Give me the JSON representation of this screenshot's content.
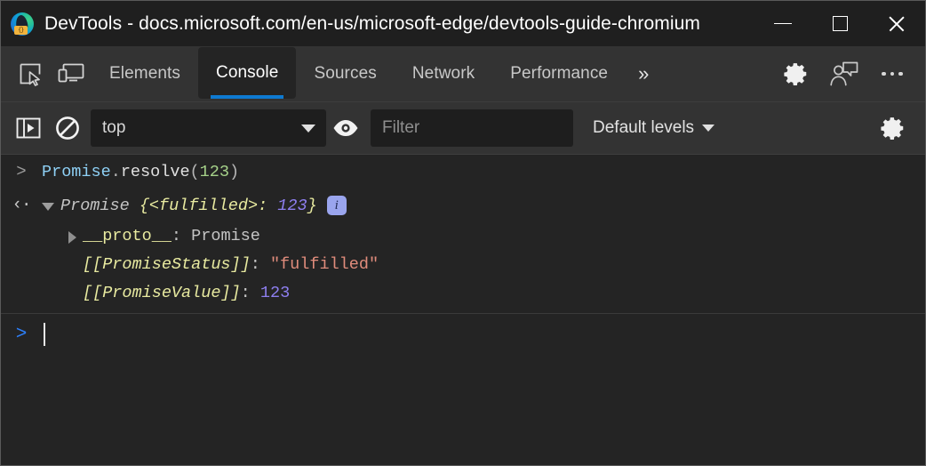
{
  "window": {
    "title": "DevTools - docs.microsoft.com/en-us/microsoft-edge/devtools-guide-chromium",
    "app_icon": "edge-devtools-icon",
    "badge_text": "{}",
    "controls": {
      "minimize": "minimize-icon",
      "maximize": "maximize-icon",
      "close": "close-icon"
    }
  },
  "tabbar": {
    "inspect_icon": "inspect-element-icon",
    "device_icon": "device-emulation-icon",
    "tabs": [
      {
        "label": "Elements",
        "active": false
      },
      {
        "label": "Console",
        "active": true
      },
      {
        "label": "Sources",
        "active": false
      },
      {
        "label": "Network",
        "active": false
      },
      {
        "label": "Performance",
        "active": false
      }
    ],
    "more_tabs": "»",
    "settings_icon": "gear-icon",
    "feedback_icon": "feedback-person-icon",
    "more_icon": "more-options-icon",
    "active_underline_color": "#0e7ad1"
  },
  "console_toolbar": {
    "sidebar_toggle_icon": "console-sidebar-toggle-icon",
    "clear_icon": "clear-console-icon",
    "context": {
      "value": "top",
      "caret": "chevron-down-icon"
    },
    "eye_icon": "live-expression-eye-icon",
    "filter": {
      "placeholder": "Filter",
      "value": ""
    },
    "levels": {
      "label": "Default levels",
      "caret": "chevron-down-icon"
    },
    "settings_icon": "gear-icon"
  },
  "console": {
    "input_row": {
      "prompt": ">",
      "tokens": [
        {
          "text": "Promise",
          "style": "ident"
        },
        {
          "text": ".",
          "style": "punc"
        },
        {
          "text": "resolve",
          "style": "plain"
        },
        {
          "text": "(",
          "style": "punc"
        },
        {
          "text": "123",
          "style": "num-green"
        },
        {
          "text": ")",
          "style": "punc"
        }
      ]
    },
    "result_row": {
      "return_arrow": "‹·",
      "disclosure": "expanded",
      "tokens": [
        {
          "text": "Promise",
          "style": "gray-italic"
        },
        {
          "text": " {<fulfilled>: ",
          "style": "key-italic"
        },
        {
          "text": "123",
          "style": "num-purple-italic"
        },
        {
          "text": "}",
          "style": "key-italic"
        }
      ],
      "info_badge": "i"
    },
    "properties": [
      {
        "disclosure": "collapsed",
        "key": "__proto__",
        "separator": ": ",
        "value": "Promise",
        "key_style": "key",
        "value_style": "gray",
        "italic": false
      },
      {
        "disclosure": "none",
        "key": "[[PromiseStatus]]",
        "separator": ": ",
        "value": "\"fulfilled\"",
        "key_style": "key",
        "value_style": "string",
        "italic": true
      },
      {
        "disclosure": "none",
        "key": "[[PromiseValue]]",
        "separator": ": ",
        "value": "123",
        "key_style": "key",
        "value_style": "num-purple",
        "italic": true
      }
    ],
    "prompt_row": {
      "caret": ">",
      "value": ""
    }
  },
  "colors": {
    "accent": "#0e7ad1",
    "prompt_blue": "#2d7ff9",
    "titlebar_bg": "#1f1f1f",
    "toolbar_bg": "#333333",
    "console_bg": "#242424",
    "info_badge_bg": "#9aa5ee"
  }
}
